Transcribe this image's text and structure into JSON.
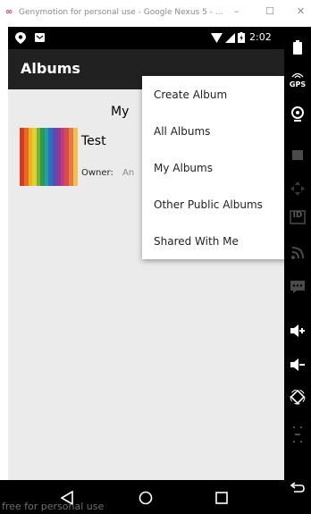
{
  "window": {
    "logo": "∞",
    "title": "Genymotion for personal use - Google Nexus 5 - ...",
    "minimize": "–",
    "maximize": "☐",
    "close": "✕"
  },
  "statusbar": {
    "time": "2:02"
  },
  "appbar": {
    "title": "Albums"
  },
  "content": {
    "heading_visible": "My",
    "album": {
      "name": "Test",
      "owner_label": "Owner:",
      "owner_value_visible": "An"
    }
  },
  "menu": {
    "items": [
      "Create Album",
      "All Albums",
      "My Albums",
      "Other Public Albums",
      "Shared With Me"
    ]
  },
  "footer": {
    "text": "free for personal use"
  },
  "sidebar": {
    "gps": "GPS",
    "id": "ID"
  },
  "colors": {
    "appbar": "#212121",
    "content_bg": "#ebebeb",
    "menu_bg": "#ffffff",
    "logo": "#e0306a"
  }
}
